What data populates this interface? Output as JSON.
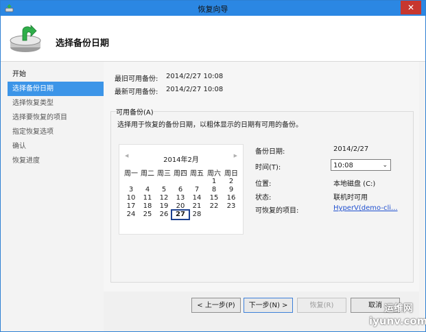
{
  "window": {
    "title": "恢复向导"
  },
  "header": {
    "title": "选择备份日期"
  },
  "nav": {
    "items": [
      {
        "label": "开始"
      },
      {
        "label": "选择备份日期"
      },
      {
        "label": "选择恢复类型"
      },
      {
        "label": "选择要恢复的项目"
      },
      {
        "label": "指定恢复选项"
      },
      {
        "label": "确认"
      },
      {
        "label": "恢复进度"
      }
    ]
  },
  "info": {
    "oldest_label": "最旧可用备份:",
    "oldest_value": "2014/2/27 10:08",
    "newest_label": "最新可用备份:",
    "newest_value": "2014/2/27 10:08"
  },
  "group": {
    "legend": "可用备份(A)",
    "description": "选择用于恢复的备份日期，以粗体显示的日期有可用的备份。"
  },
  "calendar": {
    "prev_arrow": "◀",
    "next_arrow": "▶",
    "month": "2014年2月",
    "weekdays": [
      "周一",
      "周二",
      "周三",
      "周四",
      "周五",
      "周六",
      "周日"
    ],
    "weeks": [
      [
        "",
        "",
        "",
        "",
        "",
        "1",
        "2"
      ],
      [
        "3",
        "4",
        "5",
        "6",
        "7",
        "8",
        "9"
      ],
      [
        "10",
        "11",
        "12",
        "13",
        "14",
        "15",
        "16"
      ],
      [
        "17",
        "18",
        "19",
        "20",
        "21",
        "22",
        "23"
      ],
      [
        "24",
        "25",
        "26",
        "27",
        "28",
        "",
        ""
      ]
    ],
    "selected": "27"
  },
  "details": {
    "date_label": "备份日期:",
    "date_value": "2014/2/27",
    "time_label": "时间(T):",
    "time_value": "10:08",
    "location_label": "位置:",
    "location_value": "本地磁盘 (C:)",
    "status_label": "状态:",
    "status_value": "联机时可用",
    "items_label": "可恢复的项目:",
    "items_value": "HyperV(demo-cli..."
  },
  "buttons": {
    "back": "< 上一步(P)",
    "next": "下一步(N) >",
    "recover": "恢复(R)",
    "cancel": "取消"
  },
  "watermark": {
    "line1": "运维网",
    "line2": "iyunv.com"
  },
  "colors": {
    "titlebar": "#2b87e3",
    "nav_active": "#3c95e8",
    "close": "#c7372f",
    "link": "#1f4fcf"
  }
}
